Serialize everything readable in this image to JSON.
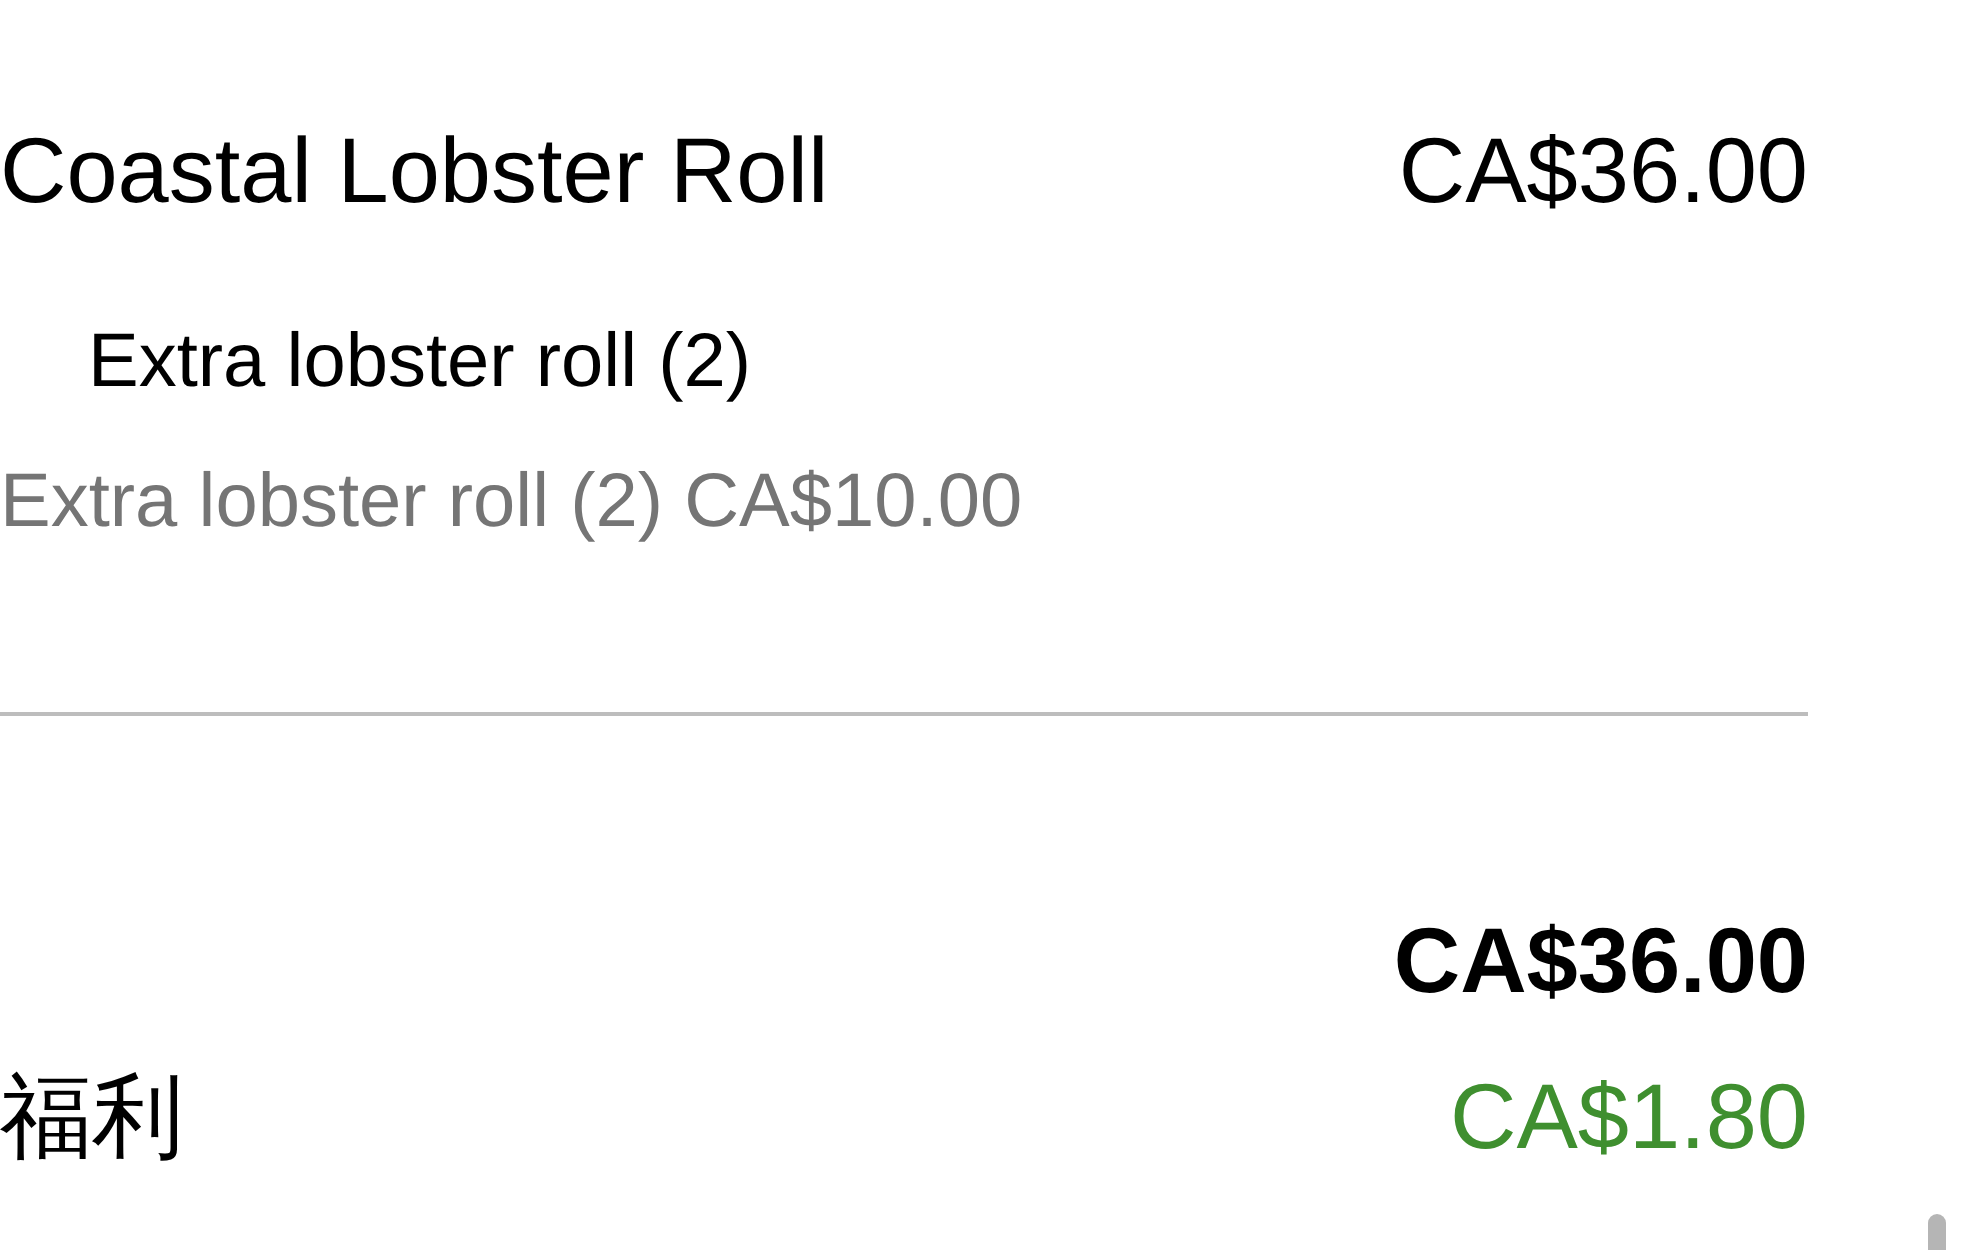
{
  "order_item": {
    "name": "Coastal Lobster Roll",
    "price": "CA$36.00",
    "modifiers": [
      {
        "title": "Extra lobster roll (2)",
        "detail": "Extra lobster roll (2) CA$10.00"
      }
    ]
  },
  "subtotal": {
    "amount": "CA$36.00"
  },
  "adjustments": [
    {
      "kind": "discount",
      "label": "福利",
      "amount": "CA$1.80"
    }
  ]
}
